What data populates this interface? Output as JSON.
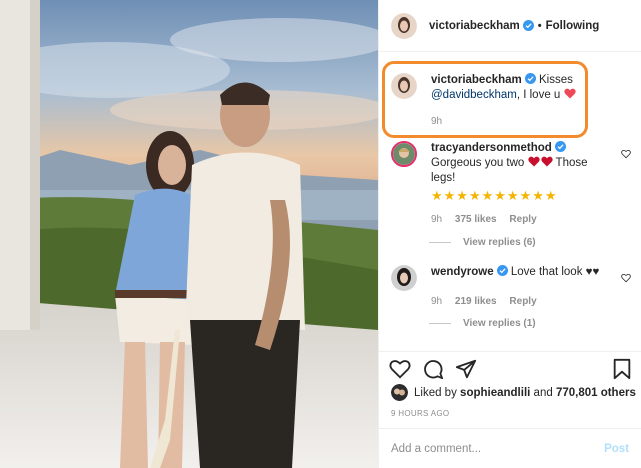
{
  "header": {
    "username": "victoriabeckham",
    "separator": "•",
    "follow_state": "Following"
  },
  "caption": {
    "username": "victoriabeckham",
    "text_prefix": "Kisses",
    "mention": "@davidbeckham",
    "text_suffix": ", I love u",
    "emoji": "heart",
    "time": "9h"
  },
  "comments": [
    {
      "username": "tracyandersonmethod",
      "line1": "Gorgeous you two",
      "line1_suffix": "Those",
      "line2": "legs!",
      "stars": "★★★★★★★★★★",
      "time": "9h",
      "likes": "375 likes",
      "reply_label": "Reply",
      "view_replies": "View replies (6)"
    },
    {
      "username": "wendyrowe",
      "text": "Love that look",
      "text_suffix": "♥♥",
      "time": "9h",
      "likes": "219 likes",
      "reply_label": "Reply",
      "view_replies": "View replies (1)"
    }
  ],
  "likes_line": {
    "prefix": "Liked by",
    "user": "sophieandlili",
    "middle": "and",
    "count": "770,801 others"
  },
  "time_ago": "9 HOURS AGO",
  "comment_input": {
    "placeholder": "Add a comment...",
    "post_label": "Post"
  },
  "colors": {
    "highlight": "#f28b2c",
    "verified": "#3897f0",
    "heart": "#ed4956",
    "star": "#f4b400",
    "post_disabled": "#b2dffc"
  },
  "icons": [
    "verified-badge-icon",
    "heart-icon",
    "comment-icon",
    "share-icon",
    "bookmark-icon",
    "heart-emoji-icon",
    "star-emoji-icon"
  ]
}
